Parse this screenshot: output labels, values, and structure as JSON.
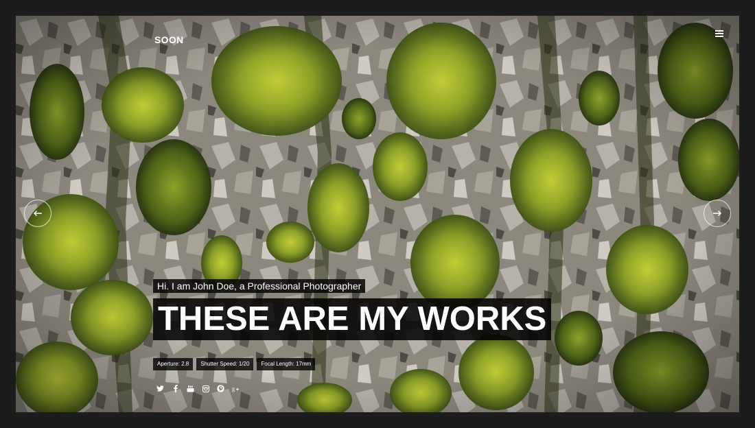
{
  "header": {
    "logo": "SOON",
    "menu_icon": "hamburger-menu-icon"
  },
  "slider": {
    "prev_icon": "arrow-left-icon",
    "next_icon": "arrow-right-icon"
  },
  "hero": {
    "subtitle": "Hi. I am John Doe, a Professional Photographer",
    "title": "THESE ARE MY WORKS"
  },
  "photo_meta": [
    "Aperture: 2.8",
    "Shutter Speed: 1/20",
    "Focal Length: 17mm"
  ],
  "social": [
    "twitter-icon",
    "facebook-icon",
    "youtube-icon",
    "instagram-icon",
    "pinterest-icon",
    "google-plus-icon"
  ],
  "colors": {
    "page_background": "#1c1c1c",
    "moss": "#8a9b25",
    "bark": "#8f8b82",
    "caption_background": "#000000",
    "text": "#ffffff"
  }
}
